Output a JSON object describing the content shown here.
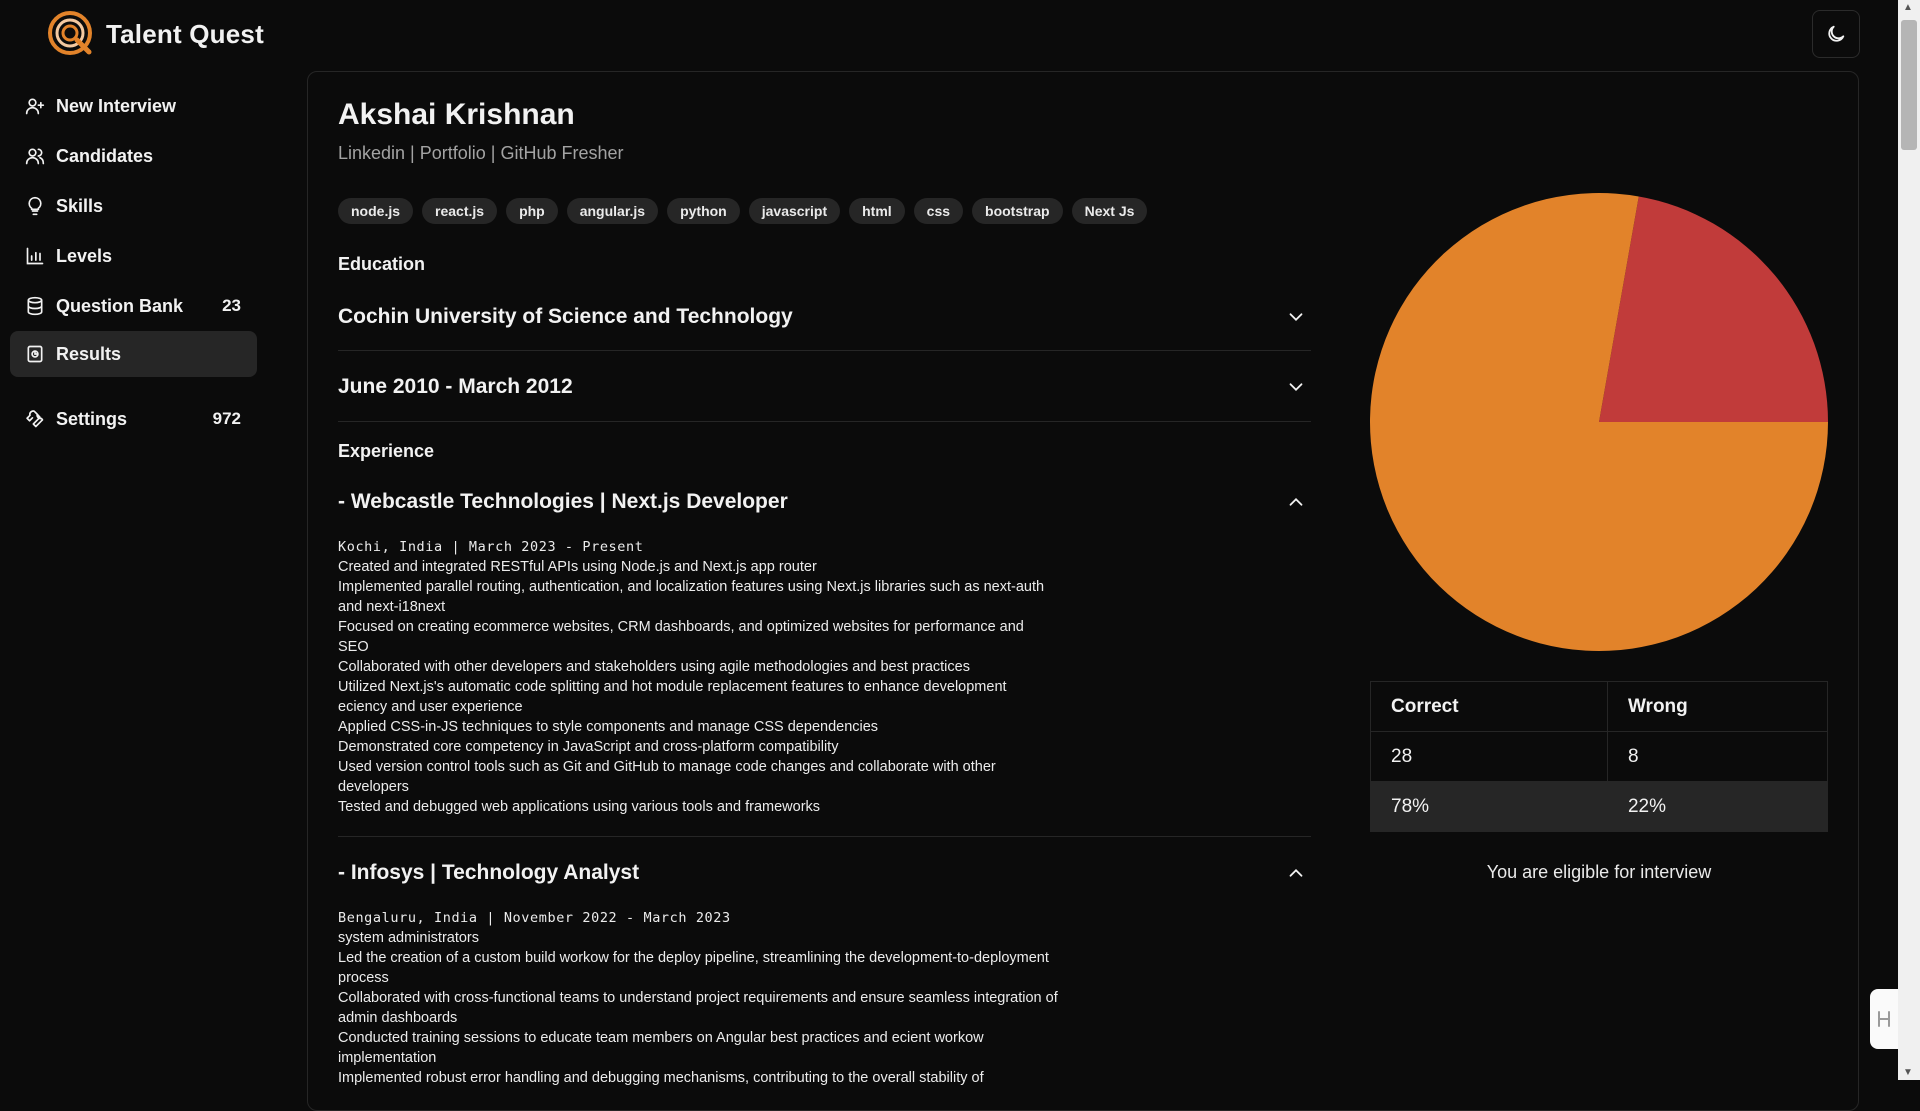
{
  "brand": {
    "name": "Talent Quest",
    "logo_icon": "target-search-icon",
    "accent": "#e2832a"
  },
  "sidebar": {
    "items": [
      {
        "label": "New Interview",
        "icon": "user-plus-icon",
        "count": ""
      },
      {
        "label": "Candidates",
        "icon": "users-icon",
        "count": ""
      },
      {
        "label": "Skills",
        "icon": "lightbulb-icon",
        "count": ""
      },
      {
        "label": "Levels",
        "icon": "bar-chart-icon",
        "count": ""
      },
      {
        "label": "Question Bank",
        "icon": "database-icon",
        "count": "23"
      },
      {
        "label": "Results",
        "icon": "results-icon",
        "count": "",
        "active": true
      },
      {
        "label": "Settings",
        "icon": "wrench-icon",
        "count": "972"
      }
    ]
  },
  "candidate": {
    "name": "Akshai Krishnan",
    "links": "Linkedin | Portfolio | GitHub Fresher",
    "skills": [
      "node.js",
      "react.js",
      "php",
      "angular.js",
      "python",
      "javascript",
      "html",
      "css",
      "bootstrap",
      "Next Js"
    ]
  },
  "education": {
    "title": "Education",
    "items": [
      {
        "label": "Cochin University of Science and Technology"
      },
      {
        "label": "June 2010 - March 2012"
      }
    ]
  },
  "experience": {
    "title": "Experience",
    "items": [
      {
        "heading": "- Webcastle Technologies | Next.js Developer",
        "meta": "Kochi, India | March 2023 - Present",
        "lines": [
          " Created and integrated RESTful APIs using Node.js and Next.js app router",
          " Implemented parallel routing, authentication, and localization features using Next.js libraries such as next-auth and next-i18next",
          " Focused on creating ecommerce websites, CRM dashboards, and optimized websites for performance and SEO",
          " Collaborated with other developers and stakeholders using agile methodologies and best practices",
          " Utilized Next.js's automatic code splitting and hot module replacement features to enhance development eciency and user experience",
          " Applied CSS-in-JS techniques to style components and manage CSS dependencies",
          " Demonstrated core competency in JavaScript and cross-platform compatibility",
          " Used version control tools such as Git and GitHub to manage code changes and collaborate with other developers",
          " Tested and debugged web applications using various tools and frameworks"
        ]
      },
      {
        "heading": "- Infosys | Technology Analyst",
        "meta": "Bengaluru, India | November 2022 - March 2023",
        "lines": [
          "system administrators",
          " Led the creation of a custom build workow for the deploy pipeline, streamlining the development-to-deployment process",
          " Collaborated with cross-functional teams to understand project requirements and ensure seamless integration of admin dashboards",
          " Conducted training sessions to educate team members on Angular best practices and ecient workow implementation",
          " Implemented robust error handling and debugging mechanisms, contributing to the overall stability of"
        ]
      }
    ]
  },
  "results": {
    "headers": [
      "Correct",
      "Wrong"
    ],
    "counts": [
      "28",
      "8"
    ],
    "percents": [
      "78%",
      "22%"
    ],
    "eligibility": "You are eligible for interview"
  },
  "chart_data": {
    "type": "pie",
    "categories": [
      "Correct",
      "Wrong"
    ],
    "values": [
      28,
      8
    ],
    "colors": [
      "#e2832a",
      "#c13b3a"
    ]
  }
}
